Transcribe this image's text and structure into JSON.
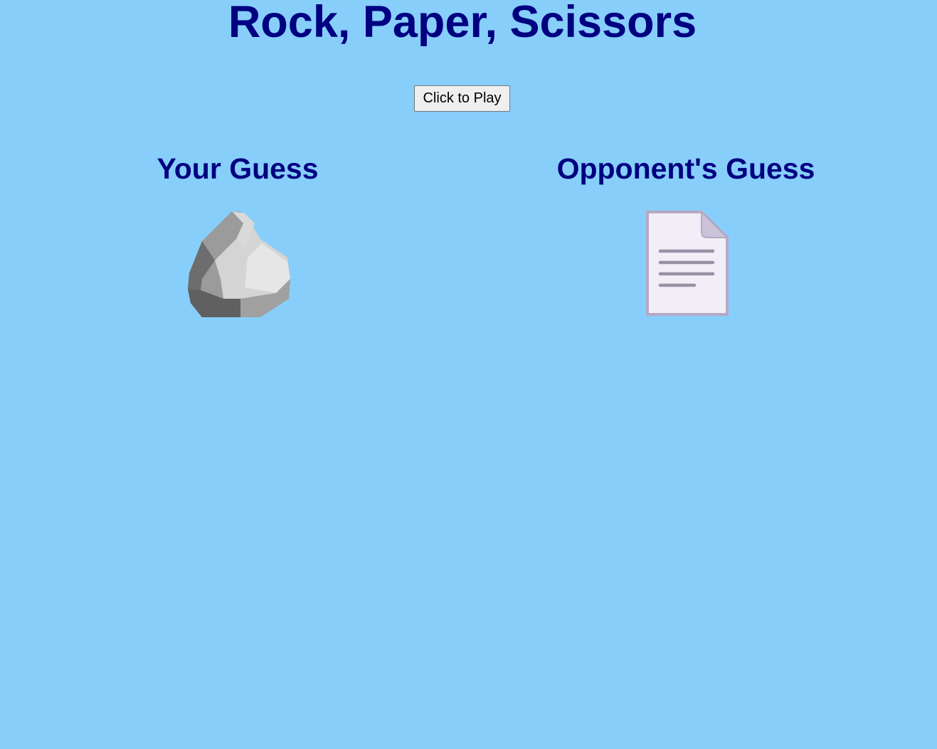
{
  "page": {
    "title": "Rock, Paper, Scissors",
    "background_color": "#87CEFA",
    "heading_color": "#000080"
  },
  "controls": {
    "play_label": "Click to Play"
  },
  "player": {
    "heading": "Your Guess",
    "choice_icon": "rock-icon"
  },
  "opponent": {
    "heading": "Opponent's Guess",
    "choice_icon": "paper-icon"
  }
}
